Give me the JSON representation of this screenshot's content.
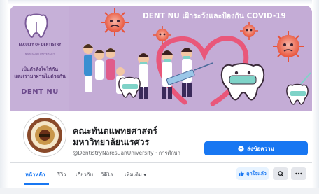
{
  "cover": {
    "title": "DENT NU เฝ้าระวังและป้องกัน COVID-19",
    "faculty_name": "FACULTY OF DENTISTRY",
    "university_name": "NARESUAN UNIVERSITY",
    "slogan_line1": "เป็นกำลังใจให้กัน",
    "slogan_line2": "และเรามาผ่านไปด้วยกัน",
    "brand": "DENT NU"
  },
  "profile": {
    "name_line1": "คณะทันตแพทยศาสตร์",
    "name_line2": "มหาวิทยาลัยนเรศวร",
    "handle": "@DentistryNaresuanUniversity · การศึกษา"
  },
  "actions": {
    "message_label": "ส่งข้อความ",
    "liked_label": "ถูกใจแล้ว"
  },
  "tabs": [
    {
      "label": "หน้าหลัก",
      "active": true
    },
    {
      "label": "รีวิว",
      "active": false
    },
    {
      "label": "เกี่ยวกับ",
      "active": false
    },
    {
      "label": "วิดีโอ",
      "active": false
    },
    {
      "label": "เพิ่มเติม ▾",
      "active": false
    }
  ],
  "icons": {
    "message": "messenger-icon",
    "like": "thumbs-up-icon",
    "search": "search-icon",
    "more": "more-icon"
  },
  "colors": {
    "accent": "#1877f2",
    "cover_bg": "#c6b0d8",
    "virus": "#e8533a",
    "brand_purple": "#5a3a78"
  }
}
